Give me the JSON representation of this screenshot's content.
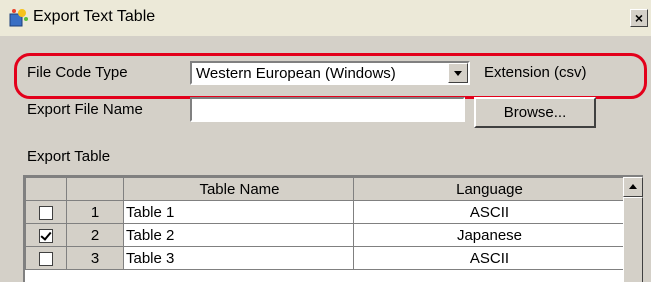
{
  "window": {
    "title": "Export Text Table",
    "app_icon": "sparkle-app-icon",
    "close_label": "×"
  },
  "file_code_type": {
    "label": "File Code Type",
    "selected": "Western European (Windows)",
    "extension_text": "Extension (csv)",
    "highlight_color": "#e3001b"
  },
  "export_file_name": {
    "label": "Export File Name",
    "value": "",
    "browse_label": "Browse..."
  },
  "export_table": {
    "label": "Export Table",
    "columns": [
      "",
      "",
      "Table Name",
      "Language"
    ],
    "rows": [
      {
        "checked": false,
        "num": "1",
        "name": "Table 1",
        "language": "ASCII"
      },
      {
        "checked": true,
        "num": "2",
        "name": "Table 2",
        "language": "Japanese"
      },
      {
        "checked": false,
        "num": "3",
        "name": "Table 3",
        "language": "ASCII"
      }
    ]
  }
}
